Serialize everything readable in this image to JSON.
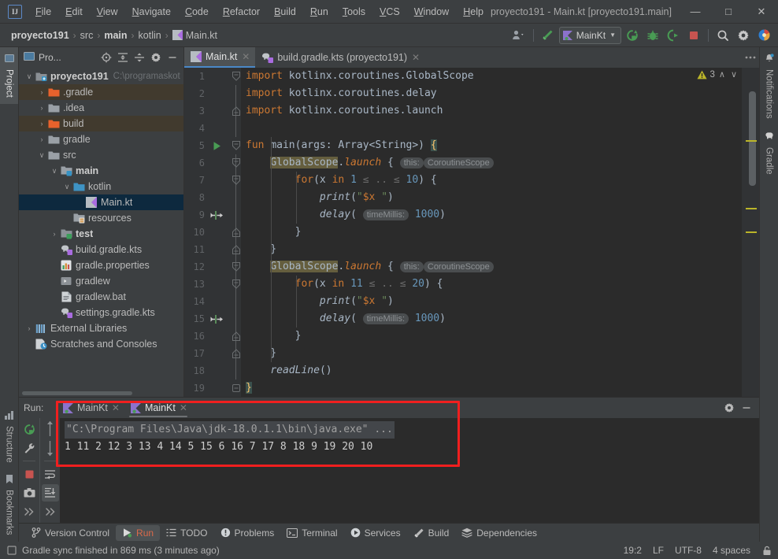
{
  "window": {
    "title": "proyecto191 - Main.kt [proyecto191.main]",
    "minimize": "—",
    "maximize": "□",
    "close": "✕",
    "logo": "IJ"
  },
  "menubar": {
    "items": [
      "File",
      "Edit",
      "View",
      "Navigate",
      "Code",
      "Refactor",
      "Build",
      "Run",
      "Tools",
      "VCS",
      "Window",
      "Help"
    ]
  },
  "breadcrumbs": {
    "items": [
      {
        "label": "proyecto191",
        "bold": true
      },
      {
        "label": "src",
        "bold": false
      },
      {
        "label": "main",
        "bold": true
      },
      {
        "label": "kotlin",
        "bold": false
      },
      {
        "label": "Main.kt",
        "bold": false,
        "icon": "kotlin-file-icon"
      }
    ],
    "separator": "›"
  },
  "toolbar": {
    "run_config": "MainKt",
    "buttons": [
      {
        "name": "account-button",
        "icon": "person-icon"
      },
      {
        "name": "build-project-button",
        "icon": "hammer-icon"
      },
      {
        "name": "rerun-button",
        "icon": "rerun-icon"
      },
      {
        "name": "debug-button",
        "icon": "bug-icon"
      },
      {
        "name": "run-coverage-button",
        "icon": "coverage-icon"
      },
      {
        "name": "stop-button",
        "icon": "stop-icon"
      },
      {
        "name": "search-everywhere-button",
        "icon": "search-icon"
      },
      {
        "name": "settings-button",
        "icon": "gear-icon"
      },
      {
        "name": "ide-trainer-button",
        "icon": "color-circle-icon"
      }
    ]
  },
  "left_strip": {
    "top": [
      {
        "label": "Project",
        "icon": "project-icon",
        "active": true
      }
    ],
    "bottom": [
      {
        "label": "Structure",
        "icon": "structure-icon",
        "active": false
      },
      {
        "label": "Bookmarks",
        "icon": "bookmark-icon",
        "active": false
      }
    ]
  },
  "right_strip": {
    "items": [
      {
        "label": "Notifications",
        "icon": "bell-icon"
      },
      {
        "label": "Gradle",
        "icon": "elephant-icon"
      }
    ]
  },
  "project_panel": {
    "title": "Pro...",
    "header_buttons": [
      {
        "name": "select-opened-file-button",
        "icon": "target-icon"
      },
      {
        "name": "expand-all-button",
        "icon": "expand-all-icon"
      },
      {
        "name": "collapse-all-button",
        "icon": "collapse-all-icon"
      },
      {
        "name": "options-button",
        "icon": "gear-icon"
      },
      {
        "name": "hide-button",
        "icon": "minus-icon"
      }
    ],
    "tree": [
      {
        "label": "proyecto191",
        "path": "C:\\programaskot",
        "indent": 0,
        "twist": "∨",
        "icon": "module-icon",
        "bold": true,
        "state": "normal"
      },
      {
        "label": ".gradle",
        "indent": 1,
        "twist": "›",
        "icon": "folder-excluded-icon",
        "bold": false,
        "state": "excluded"
      },
      {
        "label": ".idea",
        "indent": 1,
        "twist": "›",
        "icon": "folder-icon",
        "bold": false,
        "state": "normal"
      },
      {
        "label": "build",
        "indent": 1,
        "twist": "›",
        "icon": "folder-excluded-icon",
        "bold": false,
        "state": "excluded"
      },
      {
        "label": "gradle",
        "indent": 1,
        "twist": "›",
        "icon": "folder-icon",
        "bold": false,
        "state": "normal"
      },
      {
        "label": "src",
        "indent": 1,
        "twist": "∨",
        "icon": "folder-icon",
        "bold": false,
        "state": "normal"
      },
      {
        "label": "main",
        "indent": 2,
        "twist": "∨",
        "icon": "folder-source-icon",
        "bold": true,
        "state": "normal"
      },
      {
        "label": "kotlin",
        "indent": 3,
        "twist": "∨",
        "icon": "folder-source-blue-icon",
        "bold": false,
        "state": "normal"
      },
      {
        "label": "Main.kt",
        "indent": 4,
        "twist": "",
        "icon": "kotlin-file-icon",
        "bold": false,
        "state": "selected"
      },
      {
        "label": "resources",
        "indent": 3,
        "twist": "",
        "icon": "folder-resources-icon",
        "bold": false,
        "state": "normal"
      },
      {
        "label": "test",
        "indent": 2,
        "twist": "›",
        "icon": "folder-test-icon",
        "bold": true,
        "state": "normal"
      },
      {
        "label": "build.gradle.kts",
        "indent": 2,
        "twist": "",
        "icon": "gradle-kts-icon",
        "bold": false,
        "state": "normal"
      },
      {
        "label": "gradle.properties",
        "indent": 2,
        "twist": "",
        "icon": "properties-icon",
        "bold": false,
        "state": "normal"
      },
      {
        "label": "gradlew",
        "indent": 2,
        "twist": "",
        "icon": "script-icon",
        "bold": false,
        "state": "normal"
      },
      {
        "label": "gradlew.bat",
        "indent": 2,
        "twist": "",
        "icon": "bat-icon",
        "bold": false,
        "state": "normal"
      },
      {
        "label": "settings.gradle.kts",
        "indent": 2,
        "twist": "",
        "icon": "gradle-kts-icon",
        "bold": false,
        "state": "normal"
      },
      {
        "label": "External Libraries",
        "indent": 0,
        "twist": "›",
        "icon": "libraries-icon",
        "bold": false,
        "state": "normal"
      },
      {
        "label": "Scratches and Consoles",
        "indent": 0,
        "twist": "",
        "icon": "scratches-icon",
        "bold": false,
        "state": "normal"
      }
    ]
  },
  "editor": {
    "tabs": [
      {
        "label": "Main.kt",
        "icon": "kotlin-file-icon",
        "active": true,
        "close": "✕"
      },
      {
        "label": "build.gradle.kts (proyecto191)",
        "icon": "gradle-kts-icon",
        "active": false,
        "close": "✕"
      }
    ],
    "inspections": {
      "warning_count": "3",
      "up": "∧",
      "down": "∨"
    },
    "line_numbers": [
      "1",
      "2",
      "3",
      "4",
      "5",
      "6",
      "7",
      "8",
      "9",
      "10",
      "11",
      "12",
      "13",
      "14",
      "15",
      "16",
      "17",
      "18",
      "19"
    ],
    "code_lines": [
      "import kotlinx.coroutines.GlobalScope",
      "import kotlinx.coroutines.delay",
      "import kotlinx.coroutines.launch",
      "",
      "fun main(args: Array<String>) {",
      "    GlobalScope.launch { this: CoroutineScope",
      "        for(x in 1 ≤ .. ≤ 10) {",
      "            print(\"$x \")",
      "            delay( timeMillis: 1000)",
      "        }",
      "    }",
      "    GlobalScope.launch { this: CoroutineScope",
      "        for(x in 11 ≤ .. ≤ 20) {",
      "            print(\"$x \")",
      "            delay( timeMillis: 1000)",
      "        }",
      "    }",
      "    readLine()",
      "}"
    ],
    "inlay_hints": {
      "this": "this:",
      "coroutine_scope": "CoroutineScope",
      "time_millis": "timeMillis:"
    }
  },
  "run_panel": {
    "label": "Run:",
    "tabs": [
      {
        "label": "MainKt",
        "icon": "kotlin-run-icon",
        "active": false,
        "close": "✕"
      },
      {
        "label": "MainKt",
        "icon": "kotlin-run-icon",
        "active": true,
        "close": "✕"
      }
    ],
    "header_buttons": [
      {
        "name": "run-settings-button",
        "icon": "gear-icon"
      },
      {
        "name": "hide-run-panel-button",
        "icon": "minus-icon"
      }
    ],
    "left_tools": [
      {
        "name": "rerun-button",
        "icon": "rerun-icon"
      },
      {
        "name": "wrench-button",
        "icon": "wrench-icon"
      },
      {
        "name": "stop-button",
        "icon": "stop-icon"
      },
      {
        "name": "print-button",
        "icon": "camera-icon"
      },
      {
        "name": "more-button",
        "icon": "chevron-double-icon"
      }
    ],
    "right_tools": [
      {
        "name": "scroll-up-button",
        "icon": "arrow-up-icon"
      },
      {
        "name": "scroll-down-button",
        "icon": "arrow-down-icon"
      },
      {
        "name": "soft-wrap-button",
        "icon": "soft-wrap-icon"
      },
      {
        "name": "scroll-to-end-button",
        "icon": "scroll-end-icon"
      },
      {
        "name": "more-button",
        "icon": "chevron-double-icon"
      }
    ],
    "console": {
      "command": "\"C:\\Program Files\\Java\\jdk-18.0.1.1\\bin\\java.exe\" ...",
      "output": "1 11 2 12 3 13 4 14 5 15 6 16 7 17 8 18 9 19 20 10"
    }
  },
  "tool_strip": {
    "items": [
      {
        "label": "Version Control",
        "icon": "branch-icon",
        "active": false
      },
      {
        "label": "Run",
        "icon": "run-icon",
        "active": true
      },
      {
        "label": "TODO",
        "icon": "todo-icon",
        "active": false
      },
      {
        "label": "Problems",
        "icon": "problems-icon",
        "active": false
      },
      {
        "label": "Terminal",
        "icon": "terminal-icon",
        "active": false
      },
      {
        "label": "Services",
        "icon": "services-icon",
        "active": false
      },
      {
        "label": "Build",
        "icon": "hammer-icon",
        "active": false
      },
      {
        "label": "Dependencies",
        "icon": "dependencies-icon",
        "active": false
      }
    ]
  },
  "status_bar": {
    "message": "Gradle sync finished in 869 ms (3 minutes ago)",
    "caret_position": "19:2",
    "line_separator": "LF",
    "encoding": "UTF-8",
    "indent": "4 spaces",
    "lock_icon": "lock-icon"
  },
  "colors": {
    "accent": "#4a88c7",
    "annotation": "#f01f1f",
    "warning": "#bbb529",
    "keyword": "#cc7832",
    "string": "#6a8759",
    "number": "#6897bb",
    "selection": "#0d293e",
    "excluded_row": "#413a2e"
  }
}
